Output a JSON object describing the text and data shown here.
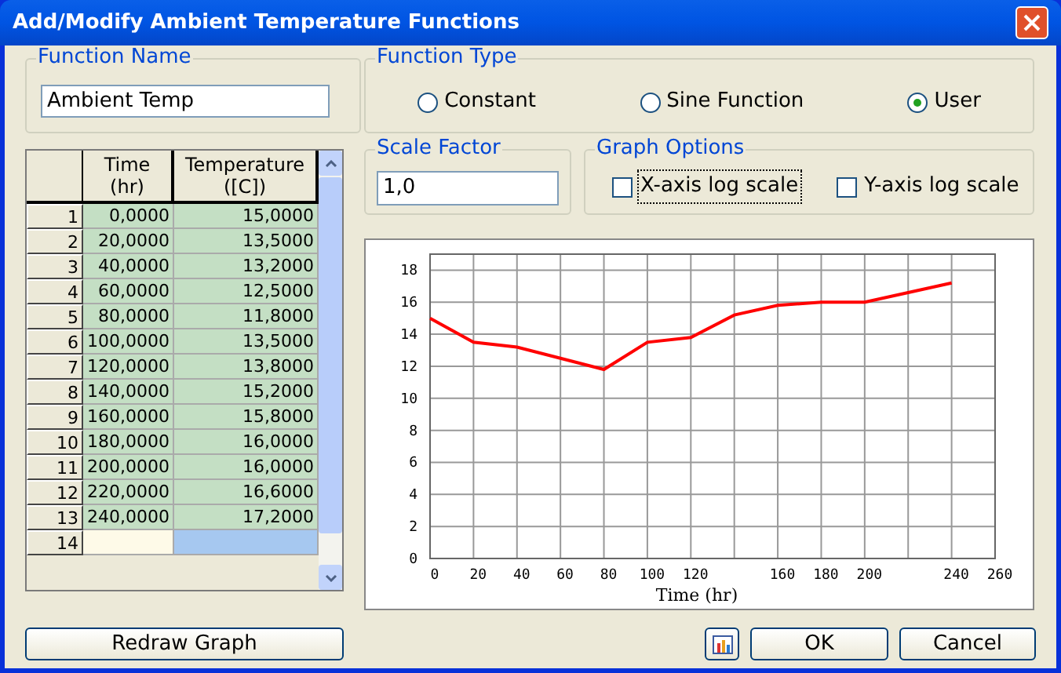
{
  "window": {
    "title": "Add/Modify Ambient Temperature Functions"
  },
  "function_name": {
    "label": "Function Name",
    "value": "Ambient Temp"
  },
  "function_type": {
    "label": "Function Type",
    "options": [
      {
        "label": "Constant",
        "selected": false
      },
      {
        "label": "Sine Function",
        "selected": false
      },
      {
        "label": "User",
        "selected": true
      }
    ]
  },
  "scale_factor": {
    "label": "Scale Factor",
    "value": "1,0"
  },
  "graph_options": {
    "label": "Graph Options",
    "options": [
      {
        "label": "X-axis log scale",
        "checked": false,
        "focused": true
      },
      {
        "label": "Y-axis log scale",
        "checked": false,
        "focused": false
      }
    ]
  },
  "table": {
    "columns": [
      "Time\n(hr)",
      "Temperature\n([C])"
    ],
    "rows": [
      {
        "index": "1",
        "cells": [
          "0,0000",
          "15,0000"
        ]
      },
      {
        "index": "2",
        "cells": [
          "20,0000",
          "13,5000"
        ]
      },
      {
        "index": "3",
        "cells": [
          "40,0000",
          "13,2000"
        ]
      },
      {
        "index": "4",
        "cells": [
          "60,0000",
          "12,5000"
        ]
      },
      {
        "index": "5",
        "cells": [
          "80,0000",
          "11,8000"
        ]
      },
      {
        "index": "6",
        "cells": [
          "100,0000",
          "13,5000"
        ]
      },
      {
        "index": "7",
        "cells": [
          "120,0000",
          "13,8000"
        ]
      },
      {
        "index": "8",
        "cells": [
          "140,0000",
          "15,2000"
        ]
      },
      {
        "index": "9",
        "cells": [
          "160,0000",
          "15,8000"
        ]
      },
      {
        "index": "10",
        "cells": [
          "180,0000",
          "16,0000"
        ]
      },
      {
        "index": "11",
        "cells": [
          "200,0000",
          "16,0000"
        ]
      },
      {
        "index": "12",
        "cells": [
          "220,0000",
          "16,6000"
        ]
      },
      {
        "index": "13",
        "cells": [
          "240,0000",
          "17,2000"
        ]
      },
      {
        "index": "14",
        "cells": [],
        "new": true
      }
    ]
  },
  "graph": {
    "chart_data": {
      "type": "line",
      "xlabel": "Time (hr)",
      "x": [
        0,
        20,
        40,
        60,
        80,
        100,
        120,
        140,
        160,
        180,
        200,
        220,
        240
      ],
      "series": [
        {
          "color": "#ff0000",
          "values": [
            15,
            13.5,
            13.2,
            12.5,
            11.8,
            13.5,
            13.8,
            15.2,
            15.8,
            16,
            16,
            16.6,
            17.2
          ]
        }
      ],
      "xlim": [
        0,
        260
      ],
      "ylim": [
        0,
        19
      ],
      "grid": true,
      "xticks": [
        0,
        20,
        40,
        60,
        80,
        100,
        120,
        160,
        180,
        200,
        240,
        260
      ],
      "yticks": [
        0,
        2,
        4,
        6,
        8,
        10,
        12,
        14,
        16,
        18
      ]
    }
  },
  "buttons": {
    "redraw": "Redraw Graph",
    "ok": "OK",
    "cancel": "Cancel"
  }
}
